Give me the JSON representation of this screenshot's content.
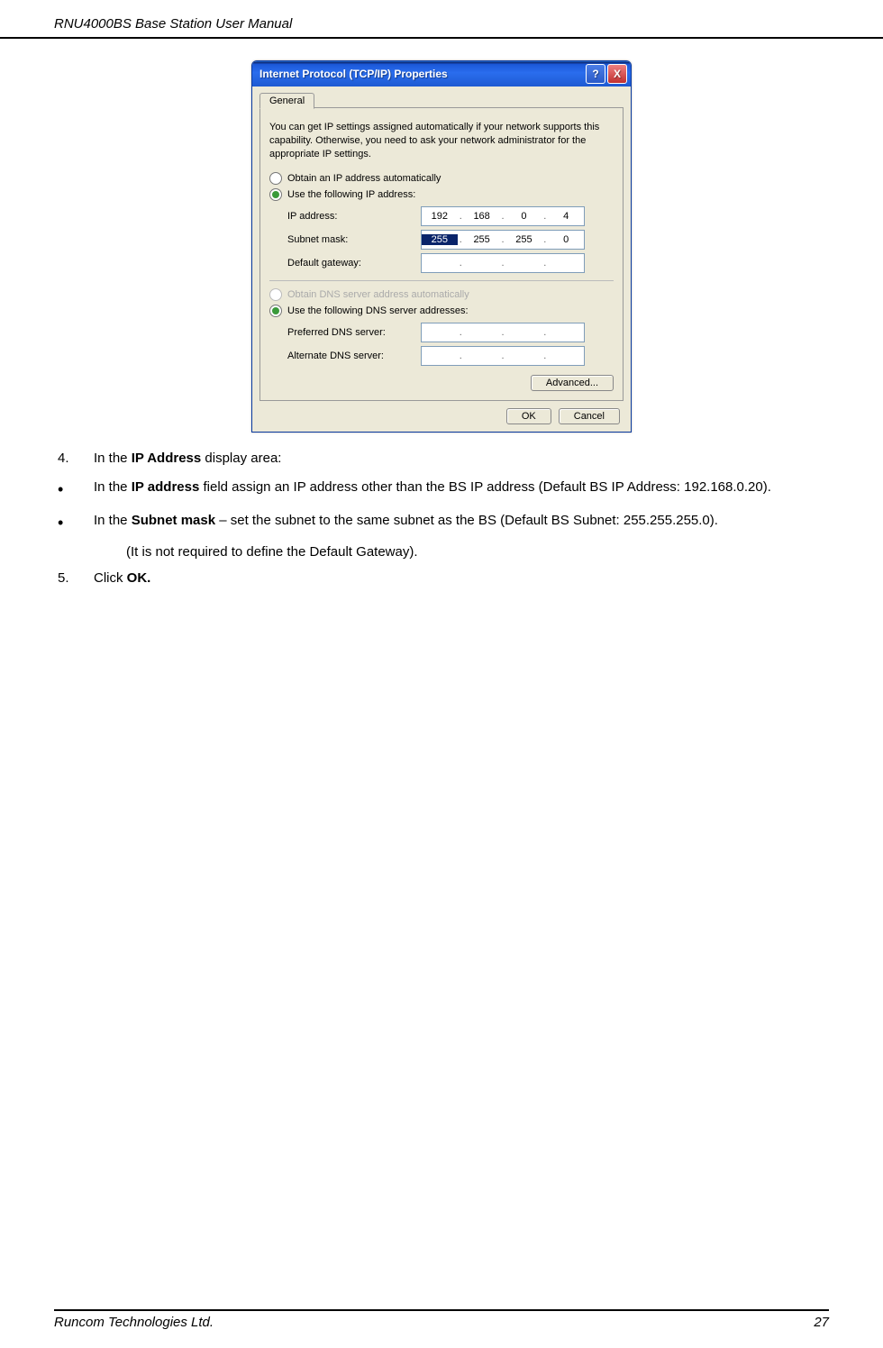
{
  "header": {
    "title": "RNU4000BS Base Station User Manual"
  },
  "dialog": {
    "title": "Internet Protocol (TCP/IP) Properties",
    "help": "?",
    "close": "X",
    "tab": "General",
    "description": "You can get IP settings assigned automatically if your network supports this capability. Otherwise, you need to ask your network administrator for the appropriate IP settings.",
    "radio_obtain_ip": "Obtain an IP address automatically",
    "radio_use_ip": "Use the following IP address:",
    "ip_label": "IP address:",
    "subnet_label": "Subnet mask:",
    "gateway_label": "Default gateway:",
    "ip": {
      "a": "192",
      "b": "168",
      "c": "0",
      "d": "4"
    },
    "subnet": {
      "a": "255",
      "b": "255",
      "c": "255",
      "d": "0"
    },
    "radio_obtain_dns": "Obtain DNS server address automatically",
    "radio_use_dns": "Use the following DNS server addresses:",
    "dns_pref_label": "Preferred DNS server:",
    "dns_alt_label": "Alternate DNS server:",
    "advanced": "Advanced...",
    "ok": "OK",
    "cancel": "Cancel"
  },
  "steps": {
    "s4_num": "4.",
    "s4_a": "In the ",
    "s4_b": "IP Address",
    "s4_c": " display area:",
    "b1_a": "In the ",
    "b1_b": "IP address",
    "b1_c": " field assign an IP address other than the BS IP address (Default BS IP Address: 192.168.0.20).",
    "b2_a": "In the ",
    "b2_b": "Subnet mask",
    "b2_c": " – set the subnet to the same subnet as the BS (Default BS Subnet: 255.255.255.0).",
    "note": "(It is not required to define the Default Gateway).",
    "s5_num": "5.",
    "s5_a": "Click ",
    "s5_b": "OK."
  },
  "footer": {
    "left": "Runcom Technologies Ltd.",
    "right": "27"
  }
}
